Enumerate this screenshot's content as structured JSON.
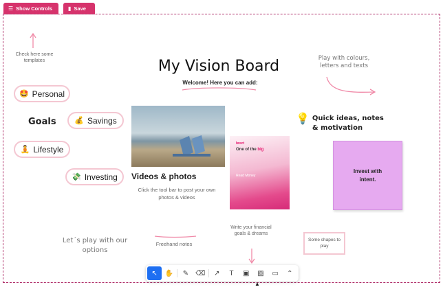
{
  "topbar": {
    "controls_label": "Show Controls",
    "controls_icon": "menu-icon",
    "save_label": "Save",
    "save_icon": "bookmark-icon"
  },
  "board": {
    "title": "My Vision Board",
    "welcome": "Welcome! Here you can add:"
  },
  "notes": {
    "templates": "Check here some templates",
    "colours": "Play with colours, letters and texts",
    "lets_play": "Let´s play with our options",
    "freehand": "Freehand notes",
    "financial": "Write your financial goals & dreams",
    "shapes": "Some shapes to play"
  },
  "goals": {
    "heading": "Goals",
    "items": [
      {
        "emoji": "🤩",
        "label": "Personal"
      },
      {
        "emoji": "💰",
        "label": "Savings"
      },
      {
        "emoji": "🧘",
        "label": "Lifestyle"
      },
      {
        "emoji": "💸",
        "label": "Investing"
      }
    ]
  },
  "photos": {
    "title": "Videos & photos",
    "subtitle": "Click the tool bar to post your own photos & videos"
  },
  "card": {
    "brand": "brect",
    "line1_a": "One of the ",
    "line1_b": "big",
    "line2": "Read Money"
  },
  "quick_ideas": {
    "icon": "lightbulb-icon",
    "text": "Quick ideas, notes & motivation"
  },
  "sticky": {
    "text": "Invest with intent."
  },
  "toolbar": {
    "tools": [
      {
        "name": "select-tool",
        "icon": "cursor-icon",
        "glyph": "↖",
        "active": true
      },
      {
        "name": "hand-tool",
        "icon": "hand-icon",
        "glyph": "✋",
        "active": false
      },
      {
        "name": "pen-tool",
        "icon": "pen-icon",
        "glyph": "✎",
        "active": false
      },
      {
        "name": "eraser-tool",
        "icon": "eraser-icon",
        "glyph": "⌫",
        "active": false
      },
      {
        "name": "arrow-tool",
        "icon": "arrow-icon",
        "glyph": "↗",
        "active": false
      },
      {
        "name": "text-tool",
        "icon": "text-icon",
        "glyph": "T",
        "active": false
      },
      {
        "name": "note-tool",
        "icon": "sticky-note-icon",
        "glyph": "▣",
        "active": false
      },
      {
        "name": "image-tool",
        "icon": "image-icon",
        "glyph": "▨",
        "active": false
      },
      {
        "name": "shape-tool",
        "icon": "rectangle-icon",
        "glyph": "▭",
        "active": false
      },
      {
        "name": "more-tool",
        "icon": "chevron-up-icon",
        "glyph": "⌃",
        "active": false
      }
    ]
  },
  "colors": {
    "brand": "#d6336c",
    "active_tool": "#1e6ff2",
    "sticky": "#e6aaf0",
    "pill_border": "#f4c7d2"
  }
}
